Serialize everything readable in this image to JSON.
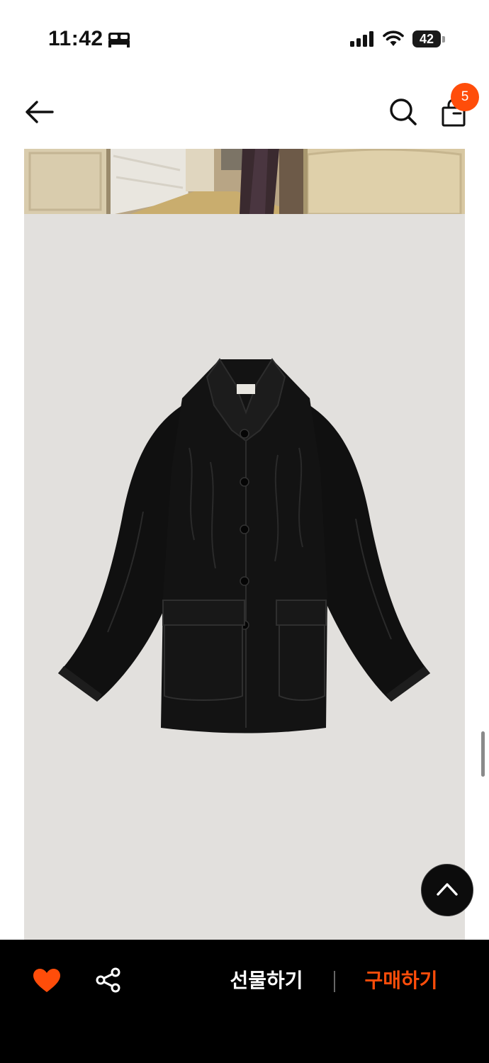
{
  "status_bar": {
    "time": "11:42",
    "battery": "42",
    "icons": [
      "bed-icon",
      "signal-icon",
      "wifi-icon",
      "battery-icon"
    ]
  },
  "header": {
    "icons": [
      "back-arrow-icon",
      "search-icon",
      "shopping-bag-icon"
    ],
    "cart_count": "5"
  },
  "product": {
    "images": [
      "room-photo",
      "black-leather-jacket"
    ],
    "panel_color": "#e2e0dd"
  },
  "scroll_top": {
    "icon": "chevron-up-icon"
  },
  "bottom_bar": {
    "like_icon": "heart-icon",
    "share_icon": "share-icon",
    "gift_label": "선물하기",
    "buy_label": "구매하기"
  },
  "colors": {
    "accent": "#ff4d0a",
    "bottom_bar_bg": "#000000"
  }
}
